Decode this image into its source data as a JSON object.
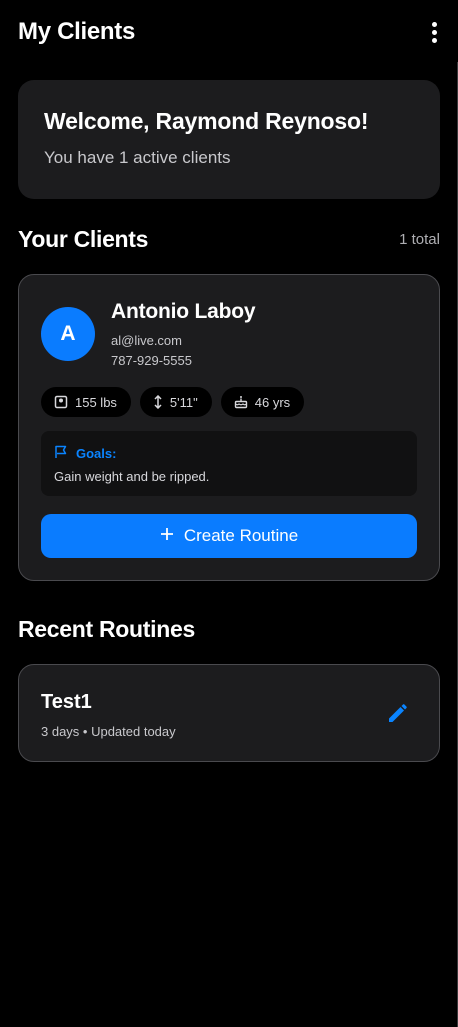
{
  "header": {
    "title": "My Clients",
    "menu_icon": "more-vert-icon"
  },
  "welcome": {
    "greeting": "Welcome, Raymond Reynoso!",
    "subtitle": "You have 1 active clients"
  },
  "clients_section": {
    "title": "Your Clients",
    "count": "1 total"
  },
  "client": {
    "initial": "A",
    "name": "Antonio Laboy",
    "email": "al@live.com",
    "phone": "787-929-5555",
    "stats": [
      {
        "icon": "scale-icon",
        "value": "155 lbs"
      },
      {
        "icon": "height-icon",
        "value": "5'11\""
      },
      {
        "icon": "cake-icon",
        "value": "46 yrs"
      }
    ],
    "goals_label": "Goals:",
    "goals_text": "Gain weight and be ripped.",
    "create_routine_label": "Create Routine"
  },
  "routines_section": {
    "title": "Recent Routines"
  },
  "routines": [
    {
      "title": "Test1",
      "meta": "3 days • Updated today"
    }
  ],
  "colors": {
    "accent": "#0a7cff",
    "background": "#000000",
    "card": "#1c1c1e",
    "border": "#4a4a4e"
  }
}
